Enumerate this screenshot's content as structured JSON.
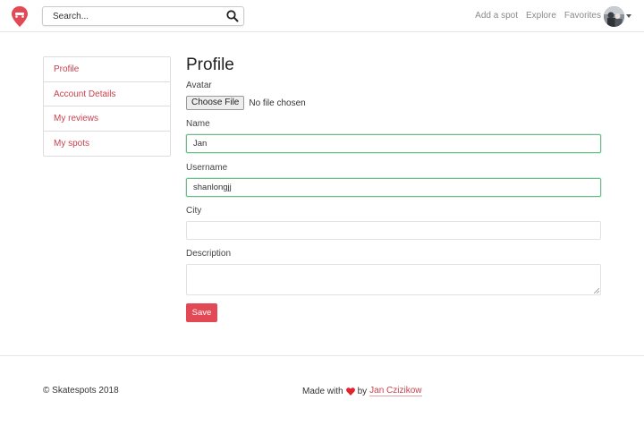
{
  "header": {
    "logo_icon": "map-pin-logo-icon",
    "search": {
      "placeholder": "Search..."
    },
    "nav": [
      "Add a spot",
      "Explore",
      "Favorites"
    ],
    "avatar_icon": "user-avatar",
    "caret_icon": "caret-down-icon"
  },
  "sidebar": {
    "items": [
      {
        "label": "Profile"
      },
      {
        "label": "Account Details"
      },
      {
        "label": "My reviews"
      },
      {
        "label": "My spots"
      }
    ]
  },
  "form": {
    "title": "Profile",
    "avatar_label": "Avatar",
    "file_button": "Choose File",
    "file_status": "No file chosen",
    "name_label": "Name",
    "name_value": "Jan",
    "username_label": "Username",
    "username_value": "shanlongjj",
    "city_label": "City",
    "city_value": "",
    "description_label": "Description",
    "description_value": "",
    "save_label": "Save"
  },
  "footer": {
    "copyright": "© Skatespots 2018",
    "made_with": "Made with",
    "by": "by",
    "author": "Jan Czizikow",
    "heart_icon": "heart-icon"
  },
  "colors": {
    "accent": "#e24955",
    "link": "#c9404e",
    "valid_border": "#6cbd8a"
  }
}
